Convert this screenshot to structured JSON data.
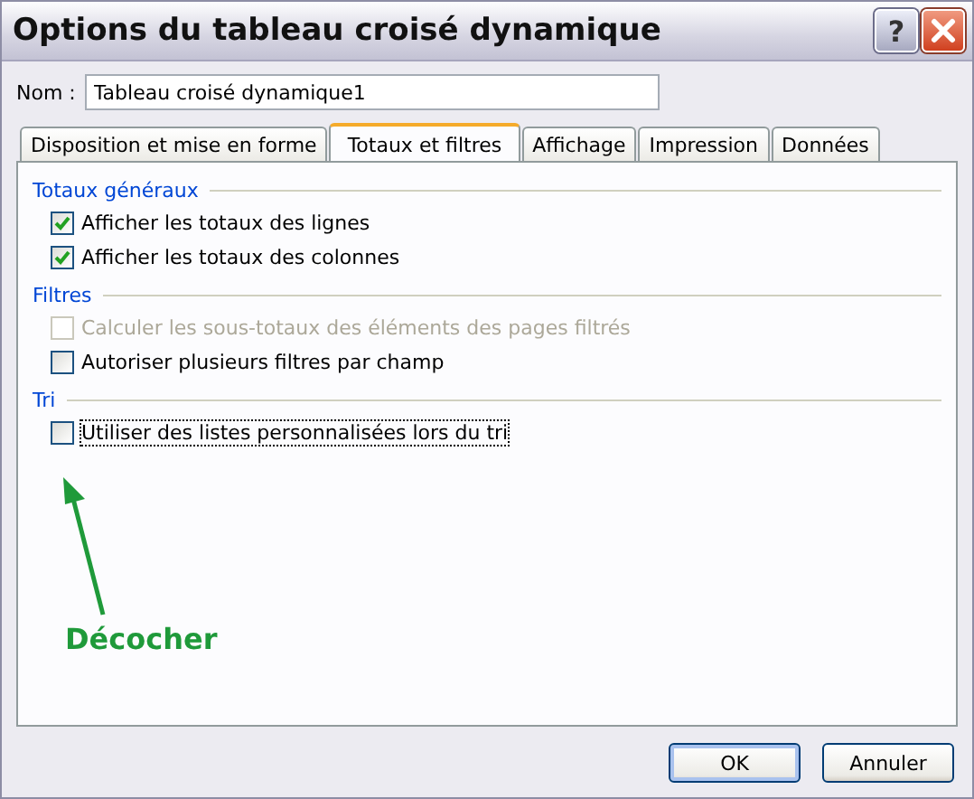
{
  "window": {
    "title": "Options du tableau croisé dynamique",
    "help_button": "?"
  },
  "name_field": {
    "label": "Nom :",
    "value": "Tableau croisé dynamique1"
  },
  "tabs": [
    {
      "label": "Disposition et mise en forme",
      "selected": false
    },
    {
      "label": "Totaux et filtres",
      "selected": true
    },
    {
      "label": "Affichage",
      "selected": false
    },
    {
      "label": "Impression",
      "selected": false
    },
    {
      "label": "Données",
      "selected": false
    }
  ],
  "sections": [
    {
      "title": "Totaux généraux",
      "options": [
        {
          "label": "Afficher les totaux des lignes",
          "checked": true,
          "disabled": false,
          "focused": false
        },
        {
          "label": "Afficher les totaux des colonnes",
          "checked": true,
          "disabled": false,
          "focused": false
        }
      ]
    },
    {
      "title": "Filtres",
      "options": [
        {
          "label": "Calculer les sous-totaux des éléments des pages filtrés",
          "checked": false,
          "disabled": true,
          "focused": false
        },
        {
          "label": "Autoriser plusieurs filtres par champ",
          "checked": false,
          "disabled": false,
          "focused": false
        }
      ]
    },
    {
      "title": "Tri",
      "options": [
        {
          "label": "Utiliser des listes personnalisées lors du tri",
          "checked": false,
          "disabled": false,
          "focused": true
        }
      ]
    }
  ],
  "annotation": {
    "text": "Décocher"
  },
  "buttons": [
    {
      "label": "OK",
      "default": true
    },
    {
      "label": "Annuler",
      "default": false
    }
  ]
}
